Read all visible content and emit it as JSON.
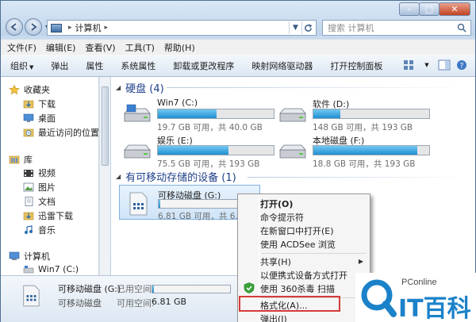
{
  "window": {
    "address": {
      "root_sep": "▸",
      "location": "计算机",
      "sep": "▸"
    },
    "search": {
      "placeholder": "搜索 计算机"
    },
    "controls": {
      "minimize": "–",
      "maximize": "□",
      "close": "✕"
    }
  },
  "menubar": {
    "items": [
      "文件(F)",
      "编辑(E)",
      "查看(V)",
      "工具(T)",
      "帮助(H)"
    ]
  },
  "toolbar": {
    "items": [
      "组织",
      "弹出",
      "属性",
      "系统属性",
      "卸载或更改程序",
      "映射网络驱动器",
      "打开控制面板"
    ]
  },
  "navpane": {
    "favorites": {
      "label": "收藏夹",
      "items": [
        "下载",
        "桌面",
        "最近访问的位置"
      ]
    },
    "libraries": {
      "label": "库",
      "items": [
        "视频",
        "图片",
        "文档",
        "迅雷下载",
        "音乐"
      ]
    },
    "computer": {
      "label": "计算机",
      "items": [
        "Win7 (C:)"
      ]
    }
  },
  "content": {
    "hdd_group": "硬盘 (4)",
    "drives": [
      {
        "name": "Win7 (C:)",
        "info": "19.7 GB 可用，共 40.0 GB",
        "used": 0.51
      },
      {
        "name": "软件 (D:)",
        "info": "148 GB 可用，共 193 GB",
        "used": 0.23
      },
      {
        "name": "娱乐 (E:)",
        "info": "75.5 GB 可用，共 193 GB",
        "used": 0.61
      },
      {
        "name": "本地磁盘 (F:)",
        "info": "18.8 GB 可用，共 193 GB",
        "used": 0.9
      }
    ],
    "removable_group": "有可移动存储的设备 (1)",
    "removable": {
      "name": "可移动磁盘 (G:)",
      "info": "6.81 GB 可用，共 6.81 GB",
      "used": 0.02
    }
  },
  "details": {
    "name": "可移动磁盘 (G:)",
    "type": "可移动磁盘",
    "used_label": "已用空间:",
    "free_label": "可用空间:",
    "free_value": "6.81 GB",
    "used": 0.02
  },
  "context_menu": {
    "items": [
      "打开(O)",
      "命令提示符",
      "在新窗口中打开(E)",
      "使用 ACDSee 浏览",
      "共享(H)",
      "以便携式设备方式打开",
      "使用 360杀毒 扫描",
      "格式化(A)...",
      "弹出(J)"
    ],
    "submenu_arrow": "▶"
  },
  "watermark": {
    "brand": "PConline",
    "name": "IT百科"
  },
  "colors": {
    "accent": "#1e3f8a",
    "bar": "#1f8fd1",
    "highlight": "#d63a3a",
    "brand": "#1b82c9"
  }
}
